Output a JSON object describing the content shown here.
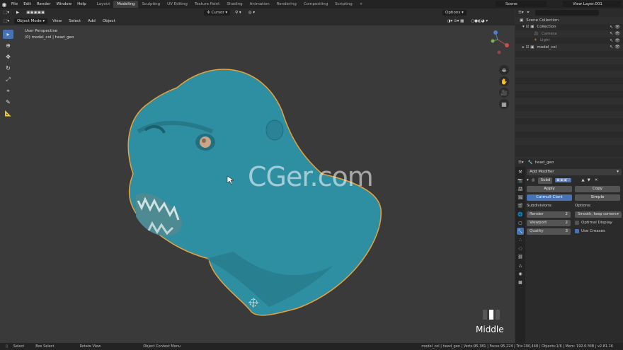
{
  "topbar": {
    "menu": [
      "File",
      "Edit",
      "Render",
      "Window",
      "Help"
    ],
    "workspaces": [
      "Layout",
      "Modeling",
      "Sculpting",
      "UV Editing",
      "Texture Paint",
      "Shading",
      "Animation",
      "Rendering",
      "Compositing",
      "Scripting"
    ],
    "active_workspace": "Modeling",
    "scene": "Scene",
    "view_layer": "View Layer.001"
  },
  "header": {
    "transform_orientation": "Cursor",
    "options_label": "Options",
    "mode": "Object Mode",
    "menus": [
      "View",
      "Select",
      "Add",
      "Object"
    ]
  },
  "viewport": {
    "perspective": "User Perspective",
    "object_path": "(0) model_col | head_geo",
    "watermark": "CGer.com",
    "mouse_button": "Middle",
    "colors": {
      "mesh": "#2e8fa3",
      "outline": "#e8a23a",
      "bg": "#3a3a3a"
    }
  },
  "outliner": {
    "root": "Scene Collection",
    "items": [
      {
        "label": "Collection",
        "depth": 1
      },
      {
        "label": "Camera",
        "depth": 2
      },
      {
        "label": "Light",
        "depth": 2
      },
      {
        "label": "model_col",
        "depth": 1
      }
    ]
  },
  "properties": {
    "object_name": "head_geo",
    "add_modifier": "Add Modifier",
    "modifier_name": "Subd",
    "apply": "Apply",
    "copy": "Copy",
    "catmull": "Catmull-Clark",
    "simple": "Simple",
    "subdivisions_label": "Subdivisions:",
    "options_label": "Options:",
    "render_label": "Render",
    "render_value": "2",
    "viewport_label": "Viewport",
    "viewport_value": "2",
    "quality_label": "Quality",
    "quality_value": "3",
    "smooth_option": "Smooth, keep corners",
    "optimal_display": "Optimal Display",
    "use_creases": "Use Creases"
  },
  "statusbar": {
    "select": "Select",
    "box_select": "Box Select",
    "rotate_view": "Rotate View",
    "context_menu": "Object Context Menu",
    "stats": "model_col | head_geo | Verts:95,381 | Faces:95,224 | Tris:190,448 | Objects:1/6 | Mem: 192.6 MiB | v2.81.16"
  }
}
